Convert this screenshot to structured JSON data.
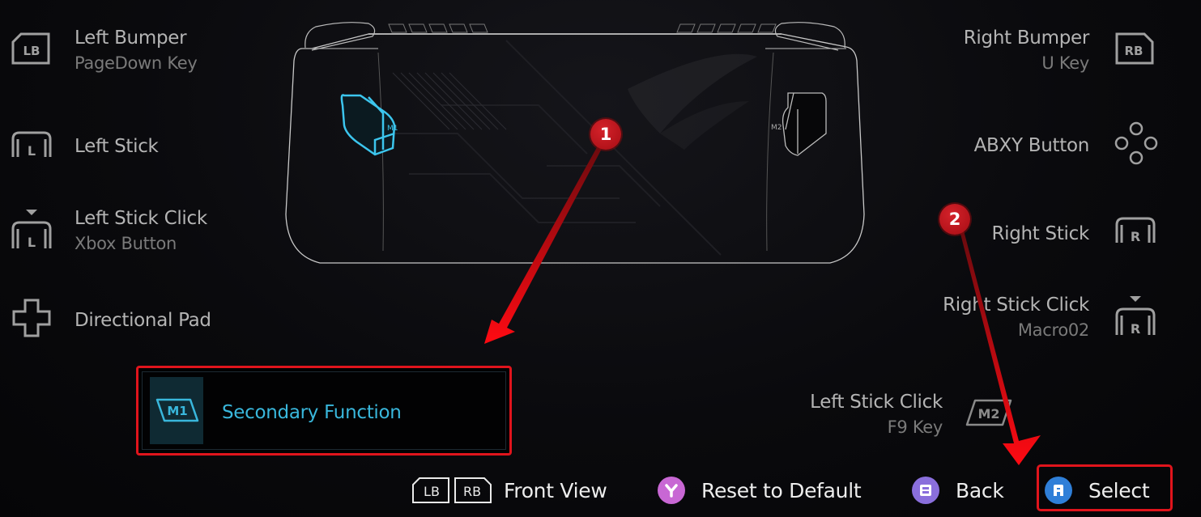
{
  "left_mappings": [
    {
      "button": "Left Bumper",
      "assignment": "PageDown Key",
      "icon": "lb-bumper-icon",
      "icon_text": "LB"
    },
    {
      "button": "Left Stick",
      "assignment": "",
      "icon": "left-stick-icon",
      "icon_text": "L"
    },
    {
      "button": "Left Stick Click",
      "assignment": "Xbox Button",
      "icon": "left-stick-click-icon",
      "icon_text": "L"
    },
    {
      "button": "Directional Pad",
      "assignment": "",
      "icon": "dpad-icon",
      "icon_text": ""
    }
  ],
  "right_mappings": [
    {
      "button": "Right Bumper",
      "assignment": "U Key",
      "icon": "rb-bumper-icon",
      "icon_text": "RB"
    },
    {
      "button": "ABXY Button",
      "assignment": "",
      "icon": "abxy-icon",
      "icon_text": ""
    },
    {
      "button": "Right Stick",
      "assignment": "",
      "icon": "right-stick-icon",
      "icon_text": "R"
    },
    {
      "button": "Right Stick Click",
      "assignment": "Macro02",
      "icon": "right-stick-click-icon",
      "icon_text": "R"
    }
  ],
  "m2_mapping": {
    "button": "Left Stick Click",
    "assignment": "F9 Key",
    "icon": "m2-key-icon",
    "icon_text": "M2"
  },
  "selected_option": {
    "label": "Secondary Function",
    "icon": "m1-key-icon",
    "icon_text": "M1"
  },
  "device": {
    "back_button_left": "M1",
    "back_button_right": "M2"
  },
  "footer": {
    "front_view": {
      "label": "Front View",
      "keys": [
        "LB",
        "RB"
      ]
    },
    "reset": {
      "label": "Reset to Default",
      "key": "Y",
      "color": "#c867d4"
    },
    "back": {
      "label": "Back",
      "key": "B",
      "color": "#8a6fdc"
    },
    "select": {
      "label": "Select",
      "key": "A",
      "color": "#2f7fd8"
    }
  },
  "annotations": [
    {
      "number": "1",
      "color": "#d4222a"
    },
    {
      "number": "2",
      "color": "#d4222a"
    }
  ],
  "colors": {
    "accent_cyan": "#39b7dc",
    "highlight_red": "#e0141c"
  }
}
